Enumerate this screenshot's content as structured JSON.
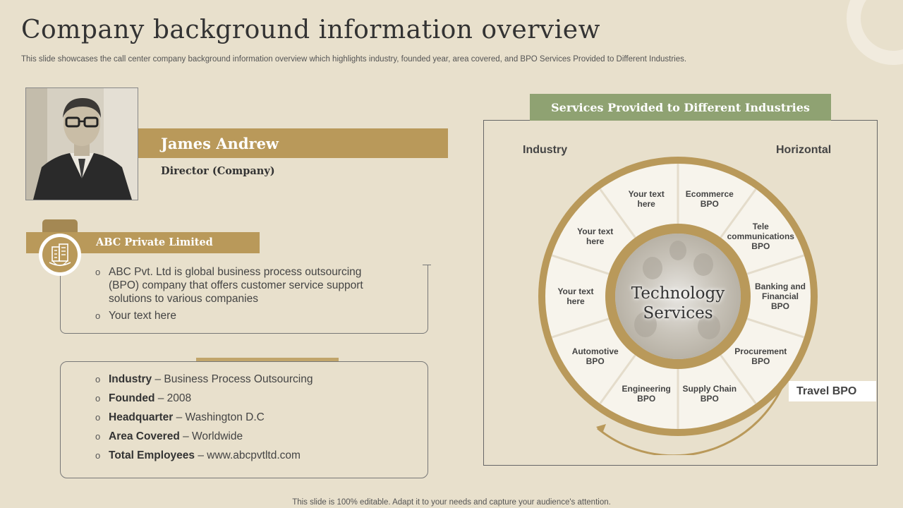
{
  "header": {
    "title": "Company background information overview",
    "subtitle": "This slide showcases the call center company background information overview which highlights industry, founded year, area covered, and BPO Services Provided to Different Industries."
  },
  "profile": {
    "name": "James Andrew",
    "role": "Director (Company)"
  },
  "company": {
    "name": "ABC Private Limited",
    "bullets": [
      "ABC Pvt. Ltd is global business process outsourcing (BPO) company that offers customer service support solutions to various companies",
      "Your text here"
    ]
  },
  "details": [
    {
      "label": "Industry",
      "value": " – Business Process Outsourcing"
    },
    {
      "label": "Founded",
      "value": " – 2008"
    },
    {
      "label": "Headquarter",
      "value": " – Washington D.C"
    },
    {
      "label": "Area Covered",
      "value": " – Worldwide"
    },
    {
      "label": "Total Employees",
      "value": " – www.abcpvtltd.com"
    }
  ],
  "services": {
    "title": "Services Provided to Different Industries",
    "label_left": "Industry",
    "label_right": "Horizontal",
    "center_line1": "Technology",
    "center_line2": "Services",
    "callout": "Travel BPO",
    "segments": [
      [
        "Your text",
        "here"
      ],
      [
        "Ecommerce",
        "BPO"
      ],
      [
        "Tele",
        "communications",
        "BPO"
      ],
      [
        "Banking and",
        "Financial",
        "BPO"
      ],
      [
        "Procurement",
        "BPO"
      ],
      [
        "Supply Chain",
        "BPO"
      ],
      [
        "Engineering",
        "BPO"
      ],
      [
        "Automotive",
        "BPO"
      ],
      [
        "Your text",
        "here"
      ],
      [
        "Your text",
        "here"
      ]
    ]
  },
  "footer": "This slide is 100% editable. Adapt it to your needs and capture your audience's attention.",
  "colors": {
    "background": "#e8e0cc",
    "gold": "#b9995a",
    "sage": "#8fa272",
    "wheel_fill": "#f7f4ec"
  }
}
